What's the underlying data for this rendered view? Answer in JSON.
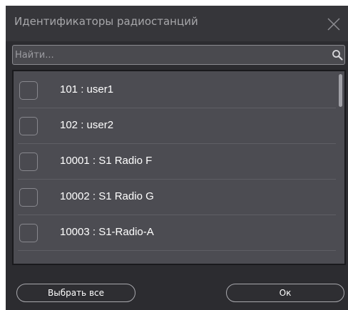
{
  "window": {
    "title": "Идентификаторы радиостанций",
    "close_icon": "close-icon"
  },
  "search": {
    "placeholder": "Найти...",
    "value": "",
    "icon": "search-icon"
  },
  "list": {
    "items": [
      {
        "label": "101 : user1",
        "checked": false
      },
      {
        "label": "102 : user2",
        "checked": false
      },
      {
        "label": "10001 : S1 Radio F",
        "checked": false
      },
      {
        "label": "10002 : S1 Radio G",
        "checked": false
      },
      {
        "label": "10003 : S1-Radio-A",
        "checked": false
      }
    ]
  },
  "footer": {
    "select_all_label": "Выбрать все",
    "ok_label": "Ок"
  },
  "colors": {
    "dialog_background": "#2c2c30",
    "list_background": "#4c4c52",
    "text": "#ffffff"
  }
}
